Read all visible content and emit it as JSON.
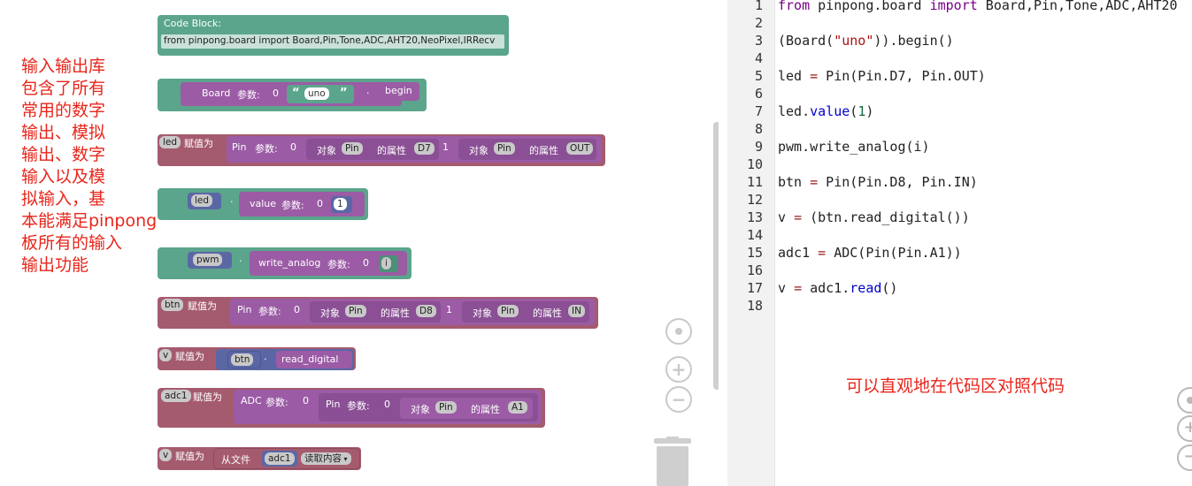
{
  "annotation_left": "输入输出库\n包含了所有\n常用的数字\n输出、模拟\n输出、数字\n输入以及模\n拟输入，基\n本能满足pinpong\n板所有的输入\n输出功能",
  "annotation_right": "可以直观地在代码区对照代码",
  "blocks": {
    "codeblock": {
      "title": "Code Block:",
      "code": "from pinpong.board import Board,Pin,Tone,ADC,AHT20,NeoPixel,IRRecv"
    },
    "board": {
      "name": "Board",
      "params": "参数:",
      "idx": "0",
      "value": "uno",
      "method": "begin"
    },
    "led_assign": {
      "var": "led",
      "assign": "赋值为",
      "cls": "Pin",
      "params": "参数:",
      "idx0": "0",
      "obj": "对象",
      "objcls": "Pin",
      "attr": "的属性",
      "attrval": "D7",
      "idx1": "1",
      "obj2": "对象",
      "objcls2": "Pin",
      "attr2": "的属性",
      "attrval2": "OUT"
    },
    "led_value": {
      "var": "led",
      "method": "value",
      "params": "参数:",
      "idx": "0",
      "val": "1"
    },
    "pwm": {
      "var": "pwm",
      "method": "write_analog",
      "params": "参数:",
      "idx": "0",
      "val": "i"
    },
    "btn_assign": {
      "var": "btn",
      "assign": "赋值为",
      "cls": "Pin",
      "params": "参数:",
      "idx0": "0",
      "obj": "对象",
      "objcls": "Pin",
      "attr": "的属性",
      "attrval": "D8",
      "idx1": "1",
      "obj2": "对象",
      "objcls2": "Pin",
      "attr2": "的属性",
      "attrval2": "IN"
    },
    "v_read": {
      "var": "v",
      "assign": "赋值为",
      "obj": "btn",
      "method": "read_digital"
    },
    "adc_assign": {
      "var": "adc1",
      "assign": "赋值为",
      "cls": "ADC",
      "params": "参数:",
      "idx": "0",
      "inner_cls": "Pin",
      "inner_params": "参数:",
      "inner_idx": "0",
      "obj": "对象",
      "objcls": "Pin",
      "attr": "的属性",
      "attrval": "A1"
    },
    "v_adc": {
      "var": "v",
      "assign": "赋值为",
      "from": "从文件",
      "obj": "adc1",
      "method": "读取内容"
    }
  },
  "editor": {
    "lines": [
      {
        "n": "1",
        "t": "from pinpong.board import Board,Pin,Tone,ADC,AHT20"
      },
      {
        "n": "2",
        "t": ""
      },
      {
        "n": "3",
        "t": "(Board(\"uno\")).begin()"
      },
      {
        "n": "4",
        "t": ""
      },
      {
        "n": "5",
        "t": "led = Pin(Pin.D7, Pin.OUT)"
      },
      {
        "n": "6",
        "t": ""
      },
      {
        "n": "7",
        "t": "led.value(1)"
      },
      {
        "n": "8",
        "t": ""
      },
      {
        "n": "9",
        "t": "pwm.write_analog(i)"
      },
      {
        "n": "10",
        "t": ""
      },
      {
        "n": "11",
        "t": "btn = Pin(Pin.D8, Pin.IN)"
      },
      {
        "n": "12",
        "t": ""
      },
      {
        "n": "13",
        "t": "v = (btn.read_digital())"
      },
      {
        "n": "14",
        "t": ""
      },
      {
        "n": "15",
        "t": "adc1 = ADC(Pin(Pin.A1))"
      },
      {
        "n": "16",
        "t": ""
      },
      {
        "n": "17",
        "t": "v = adc1.read()"
      },
      {
        "n": "18",
        "t": ""
      }
    ]
  },
  "icons": [
    "center-icon",
    "zoom-in-icon",
    "zoom-out-icon",
    "trash-icon"
  ]
}
